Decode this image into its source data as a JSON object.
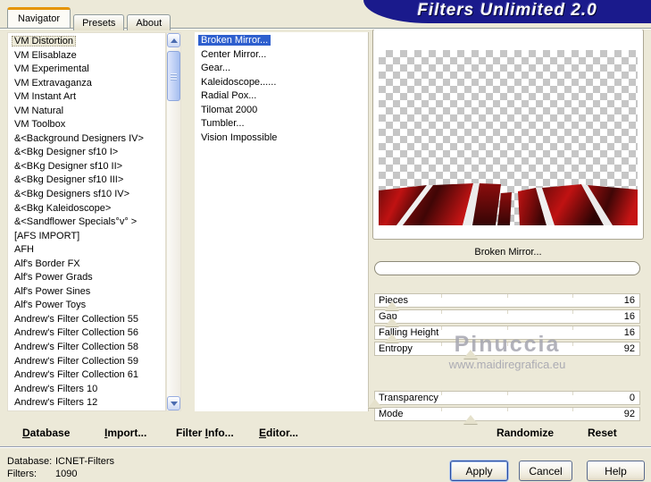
{
  "window": {
    "title": "Filters Unlimited 2.0"
  },
  "tabs": [
    {
      "id": "navigator",
      "label": "Navigator",
      "active": true
    },
    {
      "id": "presets",
      "label": "Presets",
      "active": false
    },
    {
      "id": "about",
      "label": "About",
      "active": false
    }
  ],
  "categories": {
    "selected_index": 0,
    "items": [
      "VM Distortion",
      "VM Elisablaze",
      "VM Experimental",
      "VM Extravaganza",
      "VM Instant Art",
      "VM Natural",
      "VM Toolbox",
      "&<Background Designers IV>",
      "&<Bkg Designer sf10 I>",
      "&<BKg Designer sf10 II>",
      "&<Bkg Designer sf10 III>",
      "&<Bkg Designers sf10 IV>",
      "&<Bkg Kaleidoscope>",
      "&<Sandflower Specials°v° >",
      "[AFS IMPORT]",
      "AFH",
      "Alf's Border FX",
      "Alf's Power Grads",
      "Alf's Power Sines",
      "Alf's Power Toys",
      "Andrew's Filter Collection 55",
      "Andrew's Filter Collection 56",
      "Andrew's Filter Collection 58",
      "Andrew's Filter Collection 59",
      "Andrew's Filter Collection 61",
      "Andrew's Filters 10",
      "Andrew's Filters 12"
    ]
  },
  "filters": {
    "selected_index": 0,
    "items": [
      "Broken Mirror...",
      "Center Mirror...",
      "Gear...",
      "Kaleidoscope......",
      "Radial Pox...",
      "Tilomat 2000",
      "Tumbler...",
      "Vision Impossible"
    ]
  },
  "preview": {
    "caption": "Broken Mirror...",
    "progress_value": 0
  },
  "sliders": [
    {
      "label": "Pieces",
      "value": 16,
      "pct": 6.3,
      "group": 1
    },
    {
      "label": "Gap",
      "value": 16,
      "pct": 6.3,
      "group": 1
    },
    {
      "label": "Falling Height",
      "value": 16,
      "pct": 6.3,
      "group": 1
    },
    {
      "label": "Entropy",
      "value": 92,
      "pct": 36,
      "group": 1
    },
    {
      "label": "Transparency",
      "value": 0,
      "pct": 0,
      "group": 2
    },
    {
      "label": "Mode",
      "value": 92,
      "pct": 36,
      "group": 2
    }
  ],
  "watermark": {
    "line1": "Pinuccia",
    "line2": "www.maidiregrafica.eu"
  },
  "actions": {
    "randomize": "Randomize",
    "reset": "Reset"
  },
  "menu": [
    {
      "id": "database",
      "pre": "",
      "key": "D",
      "post": "atabase"
    },
    {
      "id": "import",
      "pre": "",
      "key": "I",
      "post": "mport..."
    },
    {
      "id": "filterinfo",
      "pre": "Filter ",
      "key": "I",
      "post": "nfo..."
    },
    {
      "id": "editor",
      "pre": "",
      "key": "E",
      "post": "ditor..."
    }
  ],
  "status": {
    "database_label": "Database:",
    "database_value": "ICNET-Filters",
    "filters_label": "Filters:",
    "filters_value": "1090"
  },
  "buttons": {
    "apply": "Apply",
    "cancel": "Cancel",
    "help": "Help"
  },
  "colors": {
    "banner_navy": "#1a1a8c",
    "selection_blue": "#2e5fce",
    "dialog_beige": "#ece9d8",
    "preview_red": "#c01212",
    "tab_accent_orange": "#e59400",
    "watermark_gray": "#a5a5b0"
  }
}
